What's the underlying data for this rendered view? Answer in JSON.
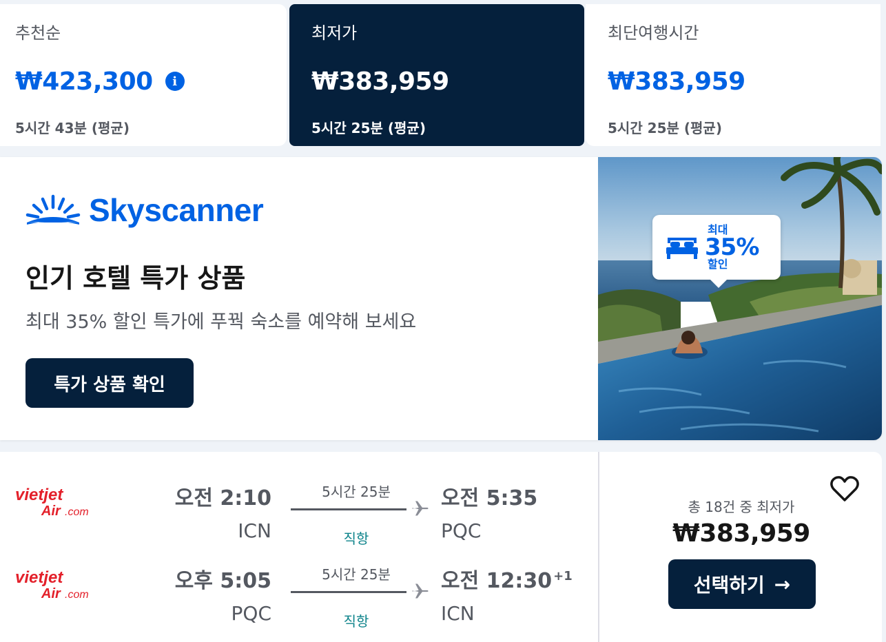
{
  "sort_tabs": [
    {
      "label": "추천순",
      "price": "₩423,300",
      "duration": "5시간 43분 (평균)",
      "info_icon": "i"
    },
    {
      "label": "최저가",
      "price": "₩383,959",
      "duration": "5시간 25분 (평균)"
    },
    {
      "label": "최단여행시간",
      "price": "₩383,959",
      "duration": "5시간 25분 (평균)"
    }
  ],
  "ad": {
    "brand": "Skyscanner",
    "title": "인기 호텔 특가 상품",
    "subtitle": "최대 35% 할인 특가에 푸꿕 숙소를 예약해 보세요",
    "button": "특가 상품 확인",
    "badge": {
      "top": "최대",
      "value": "35%",
      "bottom": "할인",
      "icon": "bed-icon"
    }
  },
  "flight": {
    "legs": [
      {
        "airline_logo": "vietjet-air-logo",
        "dep_time": "오전 2:10",
        "dep_code": "ICN",
        "duration": "5시간 25분",
        "stops": "직항",
        "arr_time": "오전 5:35",
        "arr_code": "PQC",
        "day_offset": ""
      },
      {
        "airline_logo": "vietjet-air-logo",
        "dep_time": "오후 5:05",
        "dep_code": "PQC",
        "duration": "5시간 25분",
        "stops": "직항",
        "arr_time": "오전 12:30",
        "arr_code": "ICN",
        "day_offset": "+1"
      }
    ],
    "price_note": "총 18건 중 최저가",
    "price": "₩383,959",
    "select_button": "선택하기",
    "select_arrow": "→"
  },
  "colors": {
    "accent": "#0062e3",
    "navy": "#05203c",
    "direct": "#0c838a",
    "vietjet_red": "#e3202a"
  }
}
